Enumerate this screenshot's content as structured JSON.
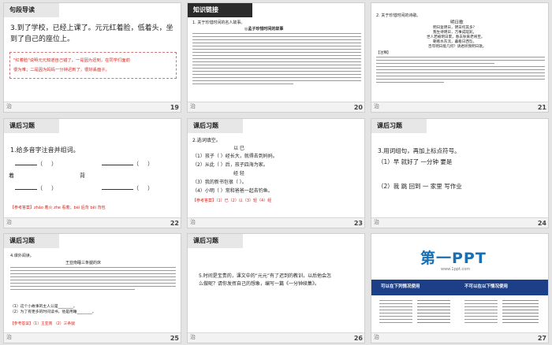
{
  "slides": [
    {
      "number": "19",
      "header": "句段导读",
      "body_line1": "3.到了学校，已经上课了。元元红着脸，低着头，坐",
      "body_line2": "到了自己的座位上。",
      "note_line1": "\"红着脸\"说明元元知道自己错了。一是因为迟到，在同学们面前",
      "note_line2": "很为难；二是因为妈妈一分钟迟到了，很好丢面子。"
    },
    {
      "number": "20",
      "header": "知识链接",
      "intro": "1. 关于珍惜时间的名人故事。",
      "subtitle": "◎孟子珍惜时间的故事"
    },
    {
      "number": "21",
      "intro": "2. 关于珍惜时间的诗歌。",
      "poem_title": "明日歌",
      "poem_lines": [
        "明日复明日，明日何其多？",
        "我生待明日，万事成蹉跎。",
        "世人若被明日累，春去秋来老将至。",
        "朝看水东流，暮看日西坠。",
        "百年明日能几何？请君听我明日歌。"
      ],
      "notes_label": "【注释】"
    },
    {
      "number": "22",
      "header": "课后习题",
      "question": "1.给多音字注音并组词。",
      "char1": "着",
      "char2": "背",
      "answer": "【参考答案】zhāo 着火 zhe 看着；bèi 后背 bēi 背包"
    },
    {
      "number": "23",
      "header": "课后习题",
      "question": "2.选词填空。",
      "words_row1": "以    已",
      "item1": "（1）孩子（    ）经长大，就得去到妈妈。",
      "item2": "（2）从此（    ）后，孩子四海为家。",
      "words_row2": "经    轻",
      "item3": "（3）我的新书包很（    ）。",
      "item4": "（4）小明（    ）常和爸爸一起去钓鱼。",
      "answer": "【参考答案】（1）已（2）以（3）轻（4）经"
    },
    {
      "number": "24",
      "header": "课后习题",
      "question": "3.用词组句，再加上标点符号。",
      "row1": "（1）早    就好了    一分钟    要是",
      "row2": "（2）我    跳    回到    一    家里    写作业"
    },
    {
      "number": "25",
      "header": "课后习题",
      "question": "4.课外阅读。",
      "story_title": "王亚南睡三条腿的床",
      "q1": "（1）这个小故事的主人公是________。",
      "q2": "（2）为了有更多的时间读书，他是用睡________。",
      "answer": "【参考答案】（1）王亚南  （2）三条腿"
    },
    {
      "number": "26",
      "header": "课后习题",
      "question_line1": "5.时间是宝贵的，课文中的“元元”有了迟到的教训，以后他会怎",
      "question_line2": "么做呢？请你发挥自己的想象，编写一篇《一分钟续集》。"
    },
    {
      "number": "27",
      "logo": "第一PPT",
      "url": "www.1ppt.com",
      "band_left": "可以在下列情况使用",
      "band_right": "不可以在以下情况使用"
    }
  ],
  "footer_icon": "doc-icon"
}
